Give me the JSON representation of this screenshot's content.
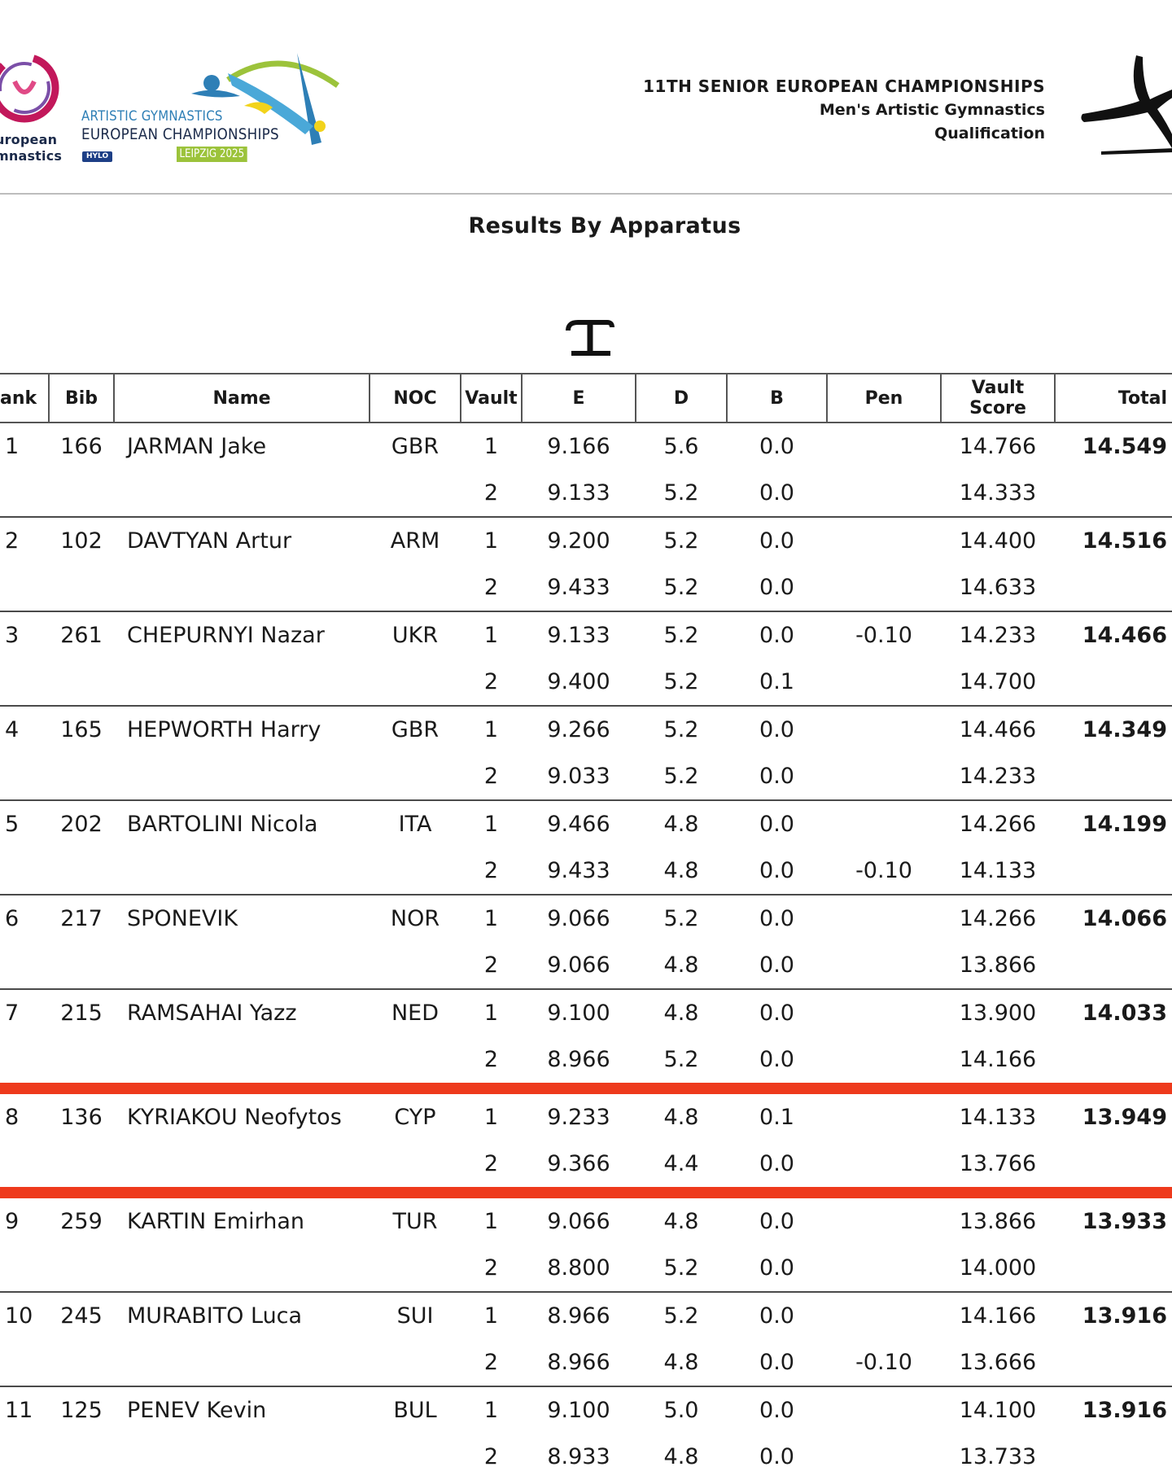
{
  "header": {
    "org_logo_text": "uropean\nmnastics",
    "champ_line1": "ARTISTIC GYMNASTICS",
    "champ_line2": "EUROPEAN CHAMPIONSHIPS",
    "hylo_badge": "HYLO",
    "leipzig_badge": "LEIPZIG 2025",
    "event_title": "11TH SENIOR EUROPEAN CHAMPIONSHIPS",
    "event_discipline": "Men's Artistic Gymnastics",
    "event_phase": "Qualification"
  },
  "page_title": "Results By Apparatus",
  "apparatus_icon": "vault-icon",
  "colors": {
    "highlight_line": "#ee3a1c",
    "rule": "#4a4a4a"
  },
  "table": {
    "headers": {
      "rank": "ank",
      "bib": "Bib",
      "name": "Name",
      "noc": "NOC",
      "vault": "Vault",
      "e": "E",
      "d": "D",
      "b": "B",
      "pen": "Pen",
      "vault_score_1": "Vault",
      "vault_score_2": "Score",
      "total": "Total"
    },
    "rows": [
      {
        "rank": "1",
        "bib": "166",
        "name": "JARMAN Jake",
        "noc": "GBR",
        "total": "14.549",
        "vaults": [
          {
            "vault": "1",
            "e": "9.166",
            "d": "5.6",
            "b": "0.0",
            "pen": "",
            "score": "14.766"
          },
          {
            "vault": "2",
            "e": "9.133",
            "d": "5.2",
            "b": "0.0",
            "pen": "",
            "score": "14.333"
          }
        ]
      },
      {
        "rank": "2",
        "bib": "102",
        "name": "DAVTYAN Artur",
        "noc": "ARM",
        "total": "14.516",
        "vaults": [
          {
            "vault": "1",
            "e": "9.200",
            "d": "5.2",
            "b": "0.0",
            "pen": "",
            "score": "14.400"
          },
          {
            "vault": "2",
            "e": "9.433",
            "d": "5.2",
            "b": "0.0",
            "pen": "",
            "score": "14.633"
          }
        ]
      },
      {
        "rank": "3",
        "bib": "261",
        "name": "CHEPURNYI Nazar",
        "noc": "UKR",
        "total": "14.466",
        "vaults": [
          {
            "vault": "1",
            "e": "9.133",
            "d": "5.2",
            "b": "0.0",
            "pen": "-0.10",
            "score": "14.233"
          },
          {
            "vault": "2",
            "e": "9.400",
            "d": "5.2",
            "b": "0.1",
            "pen": "",
            "score": "14.700"
          }
        ]
      },
      {
        "rank": "4",
        "bib": "165",
        "name": "HEPWORTH Harry",
        "noc": "GBR",
        "total": "14.349",
        "vaults": [
          {
            "vault": "1",
            "e": "9.266",
            "d": "5.2",
            "b": "0.0",
            "pen": "",
            "score": "14.466"
          },
          {
            "vault": "2",
            "e": "9.033",
            "d": "5.2",
            "b": "0.0",
            "pen": "",
            "score": "14.233"
          }
        ]
      },
      {
        "rank": "5",
        "bib": "202",
        "name": "BARTOLINI Nicola",
        "noc": "ITA",
        "total": "14.199",
        "vaults": [
          {
            "vault": "1",
            "e": "9.466",
            "d": "4.8",
            "b": "0.0",
            "pen": "",
            "score": "14.266"
          },
          {
            "vault": "2",
            "e": "9.433",
            "d": "4.8",
            "b": "0.0",
            "pen": "-0.10",
            "score": "14.133"
          }
        ]
      },
      {
        "rank": "6",
        "bib": "217",
        "name": "SPONEVIK",
        "noc": "NOR",
        "total": "14.066",
        "vaults": [
          {
            "vault": "1",
            "e": "9.066",
            "d": "5.2",
            "b": "0.0",
            "pen": "",
            "score": "14.266"
          },
          {
            "vault": "2",
            "e": "9.066",
            "d": "4.8",
            "b": "0.0",
            "pen": "",
            "score": "13.866"
          }
        ]
      },
      {
        "rank": "7",
        "bib": "215",
        "name": "RAMSAHAI Yazz",
        "noc": "NED",
        "total": "14.033",
        "vaults": [
          {
            "vault": "1",
            "e": "9.100",
            "d": "4.8",
            "b": "0.0",
            "pen": "",
            "score": "13.900"
          },
          {
            "vault": "2",
            "e": "8.966",
            "d": "5.2",
            "b": "0.0",
            "pen": "",
            "score": "14.166"
          }
        ]
      },
      {
        "rank": "8",
        "bib": "136",
        "name": "KYRIAKOU Neofytos",
        "noc": "CYP",
        "total": "13.949",
        "vaults": [
          {
            "vault": "1",
            "e": "9.233",
            "d": "4.8",
            "b": "0.1",
            "pen": "",
            "score": "14.133"
          },
          {
            "vault": "2",
            "e": "9.366",
            "d": "4.4",
            "b": "0.0",
            "pen": "",
            "score": "13.766"
          }
        ]
      },
      {
        "rank": "9",
        "bib": "259",
        "name": "KARTIN Emirhan",
        "noc": "TUR",
        "total": "13.933",
        "vaults": [
          {
            "vault": "1",
            "e": "9.066",
            "d": "4.8",
            "b": "0.0",
            "pen": "",
            "score": "13.866"
          },
          {
            "vault": "2",
            "e": "8.800",
            "d": "5.2",
            "b": "0.0",
            "pen": "",
            "score": "14.000"
          }
        ]
      },
      {
        "rank": "10",
        "bib": "245",
        "name": "MURABITO Luca",
        "noc": "SUI",
        "total": "13.916",
        "vaults": [
          {
            "vault": "1",
            "e": "8.966",
            "d": "5.2",
            "b": "0.0",
            "pen": "",
            "score": "14.166"
          },
          {
            "vault": "2",
            "e": "8.966",
            "d": "4.8",
            "b": "0.0",
            "pen": "-0.10",
            "score": "13.666"
          }
        ]
      },
      {
        "rank": "11",
        "bib": "125",
        "name": "PENEV Kevin",
        "noc": "BUL",
        "total": "13.916",
        "vaults": [
          {
            "vault": "1",
            "e": "9.100",
            "d": "5.0",
            "b": "0.0",
            "pen": "",
            "score": "14.100"
          },
          {
            "vault": "2",
            "e": "8.933",
            "d": "4.8",
            "b": "0.0",
            "pen": "",
            "score": "13.733"
          }
        ]
      }
    ]
  }
}
